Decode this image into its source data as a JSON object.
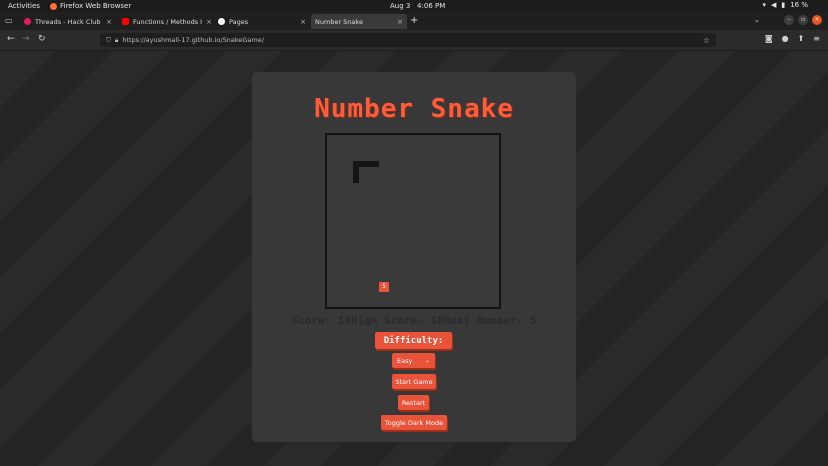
{
  "system_bar": {
    "activities": "Activities",
    "app_name": "Firefox Web Browser",
    "date": "Aug 3",
    "time": "4:06 PM",
    "battery": "16 %"
  },
  "tabs": [
    {
      "label": "Threads - Hack Club - Slac",
      "icon": "slack-icon",
      "color": "#e01e5a"
    },
    {
      "label": "Functions / Methods In Ja",
      "icon": "youtube-icon",
      "color": "#ff0000"
    },
    {
      "label": "Pages",
      "icon": "github-icon",
      "color": "#ffffff"
    },
    {
      "label": "Number Snake",
      "icon": "",
      "color": ""
    }
  ],
  "address_bar": {
    "url": "https://ayushmali-17.github.io/SnakeGame/"
  },
  "game": {
    "title": "Number Snake",
    "score_text": "Score: 10High Score: 10Next Number: 5",
    "food_number": "5",
    "difficulty_label": "Difficulty:",
    "difficulty_value": "Easy",
    "start_label": "Start Game",
    "restart_label": "Restart",
    "dark_mode_label": "Toggle Dark Mode"
  },
  "colors": {
    "accent": "#e8533a",
    "title": "#ff5c3a",
    "card": "#383838",
    "snake": "#141414"
  }
}
